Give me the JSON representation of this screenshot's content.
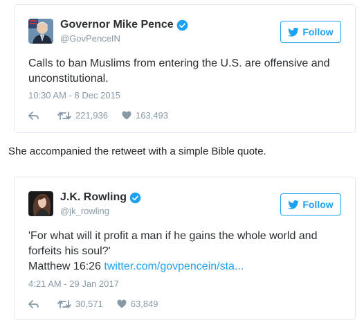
{
  "tweets": [
    {
      "display_name": "Governor Mike Pence",
      "handle": "@GovPenceIN",
      "follow_label": "Follow",
      "text_lines": [
        "Calls to ban Muslims from entering the U.S. are offensive and",
        "unconstitutional."
      ],
      "timestamp": "10:30 AM - 8 Dec 2015",
      "retweets": "221,936",
      "likes": "163,493"
    },
    {
      "display_name": "J.K. Rowling",
      "handle": "@jk_rowling",
      "follow_label": "Follow",
      "text_lines": [
        "'For what will it profit a man if he gains the whole world and",
        "forfeits his soul?'"
      ],
      "text_prefix": "Matthew 16:26 ",
      "text_link": "twitter.com/govpencein/sta...",
      "timestamp": "4:21 AM - 29 Jan 2017",
      "retweets": "30,571",
      "likes": "63,849"
    }
  ],
  "between_text": "She accompanied the retweet with a simple Bible quote.",
  "colors": {
    "accent": "#1da1f2",
    "muted": "#8899a6",
    "border": "#e1e8ed",
    "text": "#292f33"
  },
  "icons": [
    "verified-badge-icon",
    "twitter-bird-icon",
    "reply-icon",
    "retweet-icon",
    "heart-icon"
  ]
}
